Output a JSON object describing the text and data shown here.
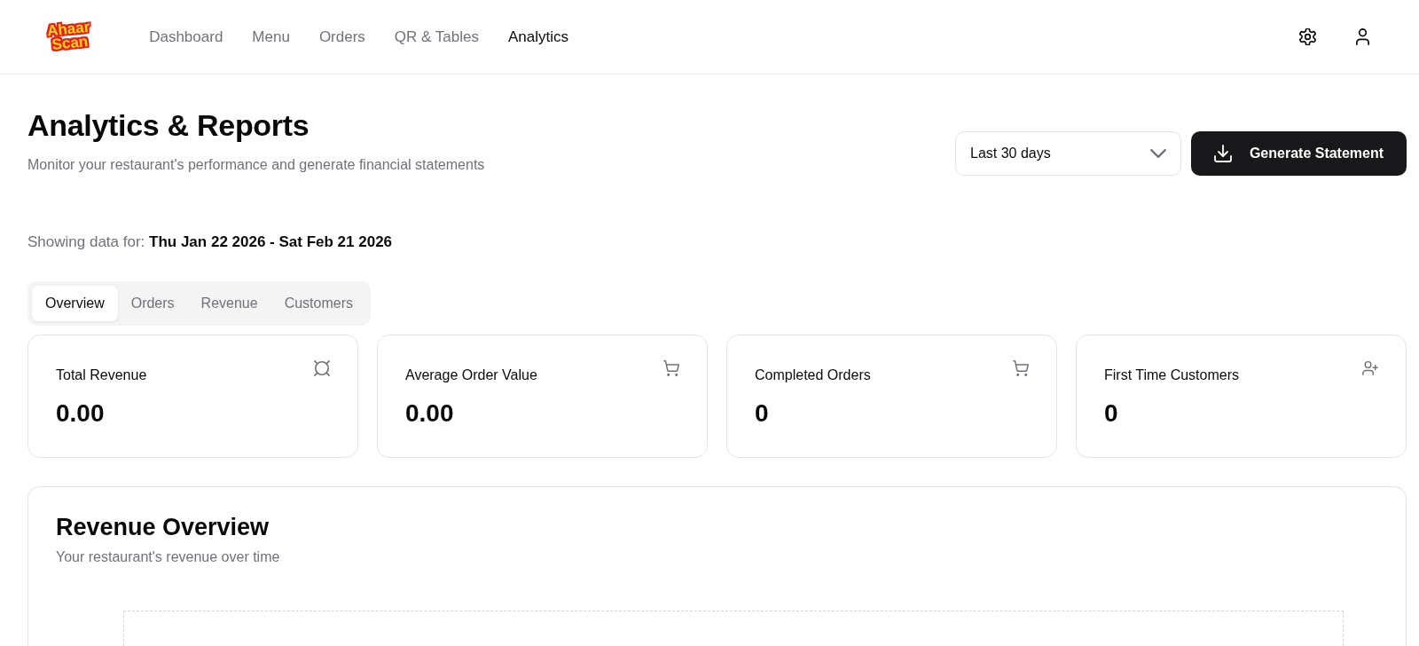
{
  "navbar": {
    "logo": [
      "Ahaar",
      "Scan"
    ],
    "links": [
      {
        "label": "Dashboard",
        "selected": false
      },
      {
        "label": "Menu",
        "selected": false
      },
      {
        "label": "Orders",
        "selected": false
      },
      {
        "label": "QR & Tables",
        "selected": false
      },
      {
        "label": "Analytics",
        "selected": true
      }
    ]
  },
  "header": {
    "title": "Analytics & Reports",
    "subtitle": "Monitor your restaurant's performance and generate financial statements",
    "range_select": {
      "value": "Last 30 days"
    },
    "generate_button": "Generate Statement"
  },
  "date_range": "Showing data for: **Thu Jan 22 2026 - Sat Feb 21 2026**",
  "tabs": [
    {
      "label": "Overview",
      "selected": true
    },
    {
      "label": "Orders",
      "selected": false
    },
    {
      "label": "Revenue",
      "selected": false
    },
    {
      "label": "Customers",
      "selected": false
    }
  ],
  "stats": [
    {
      "label": "Total Revenue",
      "value": "0.00",
      "kind": "currency"
    },
    {
      "label": "Average Order Value",
      "value": "0.00",
      "kind": "cart"
    },
    {
      "label": "Completed Orders",
      "value": "0",
      "kind": "cart"
    },
    {
      "label": "First Time Customers",
      "value": "0",
      "kind": "user-plus"
    }
  ],
  "revenue_card": {
    "title": "Revenue Overview",
    "subtitle": "Your restaurant's revenue over time"
  }
}
